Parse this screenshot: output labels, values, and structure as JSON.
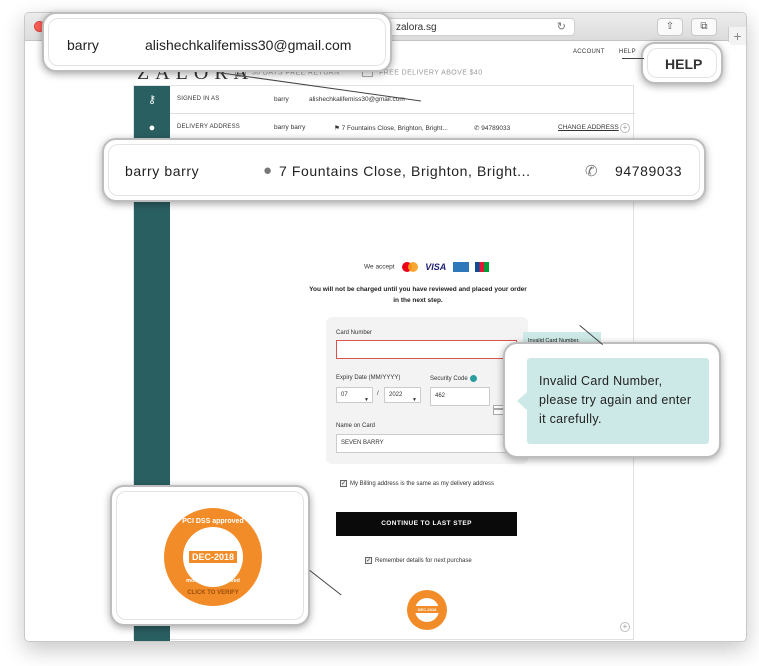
{
  "browser": {
    "url": "zalora.sg"
  },
  "topnav": {
    "account": "ACCOUNT",
    "help": "HELP"
  },
  "brand": {
    "logo": "ZALORA",
    "promo_return": "30 DAYS FREE RETURN",
    "promo_delivery": "FREE DELIVERY ABOVE $40"
  },
  "signed_in": {
    "label": "SIGNED IN AS",
    "name": "barry",
    "email": "alishechkalifemiss30@gmail.com"
  },
  "delivery": {
    "label": "DELIVERY ADDRESS",
    "name": "barry barry",
    "address": "7 Fountains Close, Brighton, Bright...",
    "phone": "94789033",
    "change_label": "CHANGE ADDRESS"
  },
  "payment": {
    "we_accept": "We accept",
    "visa": "VISA",
    "notice": "You will not be charged until you have reviewed and placed your order in the next step.",
    "card_number_label": "Card Number",
    "card_number_value": "",
    "error_mark": "!",
    "expiry_label": "Expiry Date (MM/YYYY)",
    "expiry_month": "07",
    "expiry_separator": "/",
    "expiry_year": "2022",
    "security_label": "Security Code",
    "security_value": "462",
    "name_label": "Name on Card",
    "name_value": "SEVEN BARRY",
    "error_message": "Invalid Card Number, please try again and enter it carefully.",
    "billing_same": "My Billing address is the same as my delivery address",
    "continue_label": "CONTINUE TO LAST STEP",
    "remember": "Remember details for next purchase"
  },
  "badge": {
    "top": "PCI DSS approved",
    "year": "DEC-2018",
    "middle": "more security - used",
    "bottom": "CLICK TO VERIFY"
  },
  "zoom": {
    "help": "HELP",
    "signed_name": "barry",
    "signed_email": "alishechkalifemiss30@gmail.com",
    "delivery_name": "barry barry",
    "delivery_address": "7 Fountains Close, Brighton, Bright...",
    "delivery_phone": "94789033",
    "error_message": "Invalid Card Number, please try again and enter it carefully."
  },
  "colors": {
    "accent_teal": "#2a5f62",
    "error_red": "#d9534f",
    "tooltip_bg": "#cde9e7",
    "badge_orange": "#f28c28"
  }
}
